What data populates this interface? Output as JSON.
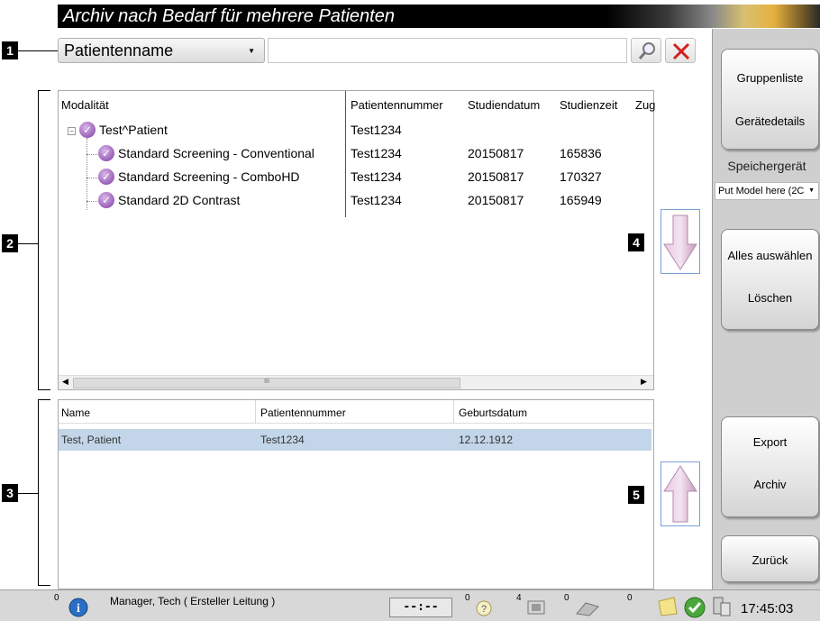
{
  "window": {
    "title": "Archiv nach Bedarf für mehrere Patienten"
  },
  "callouts": [
    "1",
    "2",
    "3",
    "4",
    "5"
  ],
  "search": {
    "field_selected": "Patientenname",
    "input_value": "",
    "search_icon": "magnifier-icon",
    "clear_icon": "red-x-icon"
  },
  "study_table": {
    "columns": [
      "Modalität",
      "Patientennummer",
      "Studiendatum",
      "Studienzeit",
      "Zug"
    ],
    "patient_node": {
      "label": "Test^Patient",
      "patient_id": "Test1234"
    },
    "studies": [
      {
        "label": "Standard Screening - Conventional",
        "patient_id": "Test1234",
        "date": "20150817",
        "time": "165836"
      },
      {
        "label": "Standard Screening - ComboHD",
        "patient_id": "Test1234",
        "date": "20150817",
        "time": "170327"
      },
      {
        "label": "Standard 2D Contrast",
        "patient_id": "Test1234",
        "date": "20150817",
        "time": "165949"
      }
    ],
    "scroll_thumb": "III"
  },
  "patient_table": {
    "columns": [
      "Name",
      "Patientennummer",
      "Geburtsdatum"
    ],
    "rows": [
      {
        "name": "Test, Patient",
        "patient_id": "Test1234",
        "dob": "12.12.1912"
      }
    ]
  },
  "sidebar": {
    "group_list": "Gruppenliste",
    "device_details": "Gerätedetails",
    "storage_label": "Speichergerät",
    "storage_selected": "Put Model here (2C",
    "select_all": "Alles auswählen",
    "delete": "Löschen",
    "export": "Export",
    "archive": "Archiv",
    "back": "Zurück"
  },
  "statusbar": {
    "notifications": "0",
    "user": "Manager, Tech ( Ersteller Leitung )",
    "timer": "--:--",
    "count_unread": "0",
    "count_queue": "4",
    "count_print": "0",
    "count_other": "0",
    "clock": "17:45:03",
    "colors": {
      "accent": "#9b5fb8",
      "selection": "#c3d5e8"
    }
  }
}
